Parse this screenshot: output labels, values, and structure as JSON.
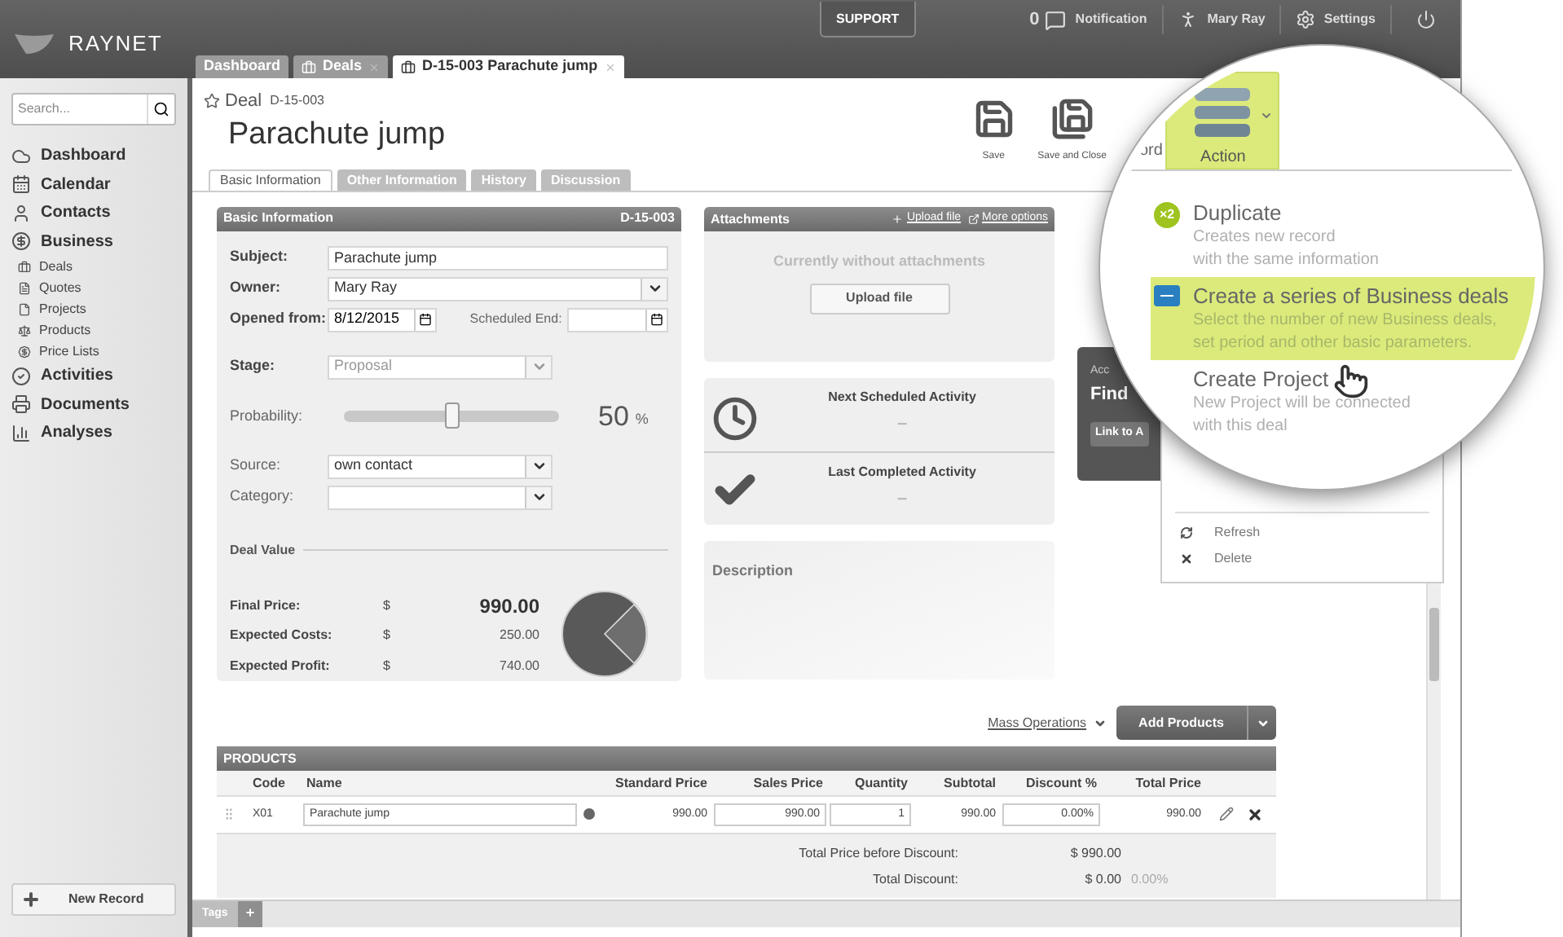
{
  "app": {
    "logo": "RAYNET"
  },
  "header": {
    "support": "SUPPORT",
    "notification_count": "0",
    "notification": "Notification",
    "user": "Mary Ray",
    "settings": "Settings"
  },
  "tabs": [
    {
      "label": "Dashboard",
      "kind": "plain",
      "closable": false,
      "selected": false
    },
    {
      "label": "Deals",
      "kind": "deal",
      "closable": true,
      "selected": false
    },
    {
      "label": "D-15-003 Parachute jump",
      "kind": "deal",
      "closable": true,
      "selected": true
    }
  ],
  "sidebar": {
    "search_placeholder": "Search...",
    "items": [
      {
        "label": "Dashboard"
      },
      {
        "label": "Calendar"
      },
      {
        "label": "Contacts"
      },
      {
        "label": "Business",
        "children": [
          {
            "label": "Deals"
          },
          {
            "label": "Quotes"
          },
          {
            "label": "Projects"
          },
          {
            "label": "Products"
          },
          {
            "label": "Price Lists"
          }
        ]
      },
      {
        "label": "Activities"
      },
      {
        "label": "Documents"
      },
      {
        "label": "Analyses"
      }
    ],
    "new_record": "New Record"
  },
  "record": {
    "type": "Deal",
    "code": "D-15-003",
    "name": "Parachute jump",
    "toolbar": [
      "Save",
      "Save and Close"
    ],
    "covered_label": "ord"
  },
  "record_tabs": [
    {
      "label": "Basic Information",
      "selected": true
    },
    {
      "label": "Other Information",
      "selected": false
    },
    {
      "label": "History",
      "selected": false
    },
    {
      "label": "Discussion",
      "selected": false
    }
  ],
  "basic_info": {
    "title": "Basic Information",
    "code": "D-15-003",
    "fields": [
      {
        "kind": "text",
        "label": "Subject:",
        "value": "Parachute jump",
        "required": true
      },
      {
        "kind": "select",
        "label": "Owner:",
        "value": "Mary Ray",
        "required": true,
        "disabled": false,
        "wide": true
      },
      {
        "kind": "dates",
        "label": "Opened from:",
        "value": "8/12/2015",
        "label_2": "Scheduled End:",
        "required": true
      },
      {
        "kind": "select",
        "label": "Stage:",
        "value": "Proposal",
        "required": true,
        "disabled": true,
        "wide": false
      },
      {
        "kind": "slider",
        "label": "Probability:",
        "level": 0.5,
        "reading": "50",
        "unit": "%",
        "required": false
      },
      {
        "kind": "select",
        "label": "Source:",
        "value": "own contact",
        "required": false,
        "disabled": false,
        "wide": false
      },
      {
        "kind": "select",
        "label": "Category:",
        "required": false,
        "disabled": false,
        "wide": false
      }
    ],
    "deal_value": {
      "title": "Deal Value",
      "rows": [
        {
          "label": "Final Price:",
          "currency": "$",
          "value": "990.00",
          "main": true
        },
        {
          "label": "Expected Costs:",
          "currency": "$",
          "value": "250.00",
          "main": false
        },
        {
          "label": "Expected Profit:",
          "currency": "$",
          "value": "740.00",
          "main": false
        }
      ]
    }
  },
  "attachments": {
    "title": "Attachments",
    "upload_link": "Upload file",
    "more_link": "More options",
    "empty": "Currently without attachments",
    "upload_button": "Upload file"
  },
  "activities": [
    {
      "kind": "next",
      "title": "Next Scheduled Activity",
      "value": "–"
    },
    {
      "kind": "last",
      "title": "Last Completed Activity",
      "value": "–"
    }
  ],
  "description": {
    "title": "Description"
  },
  "side_card": {
    "label": "Acc",
    "title": "Find",
    "button": "Link to A"
  },
  "products": {
    "mass_operations": "Mass Operations",
    "add_button": "Add Products",
    "title": "PRODUCTS",
    "columns": [
      "Code",
      "Name",
      "Standard Price",
      "Sales Price",
      "Quantity",
      "Subtotal",
      "Discount %",
      "Total Price"
    ],
    "rows": [
      {
        "code": "X01",
        "name": "Parachute jump",
        "standard_price": "990.00",
        "sales_price": "990.00",
        "quantity": "1",
        "subtotal": "990.00",
        "discount": "0.00%",
        "total_price": "990.00"
      }
    ],
    "summary": [
      {
        "label": "Total Price before Discount:",
        "value": "$ 990.00"
      },
      {
        "label": "Total Discount:",
        "value": "$ 0.00",
        "extra": "0.00%"
      }
    ]
  },
  "footer": {
    "tags": "Tags",
    "add": "+"
  },
  "action_menu": {
    "button": "Action",
    "items": [
      {
        "kind": "duplicate",
        "badge": "×2",
        "title": "Duplicate",
        "description": [
          "Creates new record",
          "with the same information"
        ],
        "selected": false
      },
      {
        "kind": "series",
        "title": "Create a series of Business deals",
        "description": [
          "Select the number of new Business deals,",
          "set period and other basic parameters."
        ],
        "selected": true
      },
      {
        "kind": "project",
        "title": "Create Project",
        "description": [
          "New Project will be connected",
          "with this deal"
        ],
        "selected": false
      }
    ],
    "more": [
      "Refresh",
      "Delete"
    ]
  }
}
